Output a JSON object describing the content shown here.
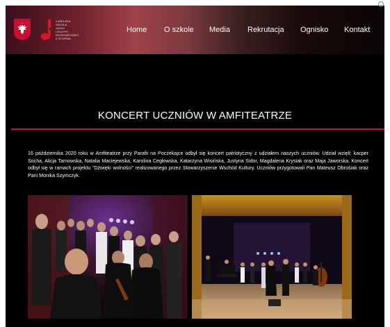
{
  "header": {
    "logo_lines": [
      "Lubelska",
      "Szkoła",
      "Jazzu",
      "i Muzyki",
      "Rozrywkowej",
      "II stopnia"
    ],
    "nav": [
      "Home",
      "O szkole",
      "Media",
      "Rekrutacja",
      "Ognisko",
      "Kontakt"
    ]
  },
  "article": {
    "title": "KONCERT UCZNIÓW W AMFITEATRZE",
    "body": "16 października 2020 roku w Amfiteatrze przy Parafii na Poczekajce odbył się koncert patriotyczny z udziałem naszych uczniów. Udział wzięli: kacper Socha, Alicja Tarnowska, Natalia Maciejewska, Karolina Cegłowska, Katarzyna Wisińska, Justyna Sidor, Magdalena Krysiak oraz Maja Jaworska. Koncert odbył się w ramach projektu \"Dźwięki wolności\" realizowanego przez Stowarzyszenie Wschód Kultury. Uczniów przygotowali Pan Mateusz Obrośiak oraz Pani Monika Szymczyk."
  },
  "colors": {
    "accent": "#c8102e",
    "background": "#000000",
    "text": "#ffffff"
  }
}
